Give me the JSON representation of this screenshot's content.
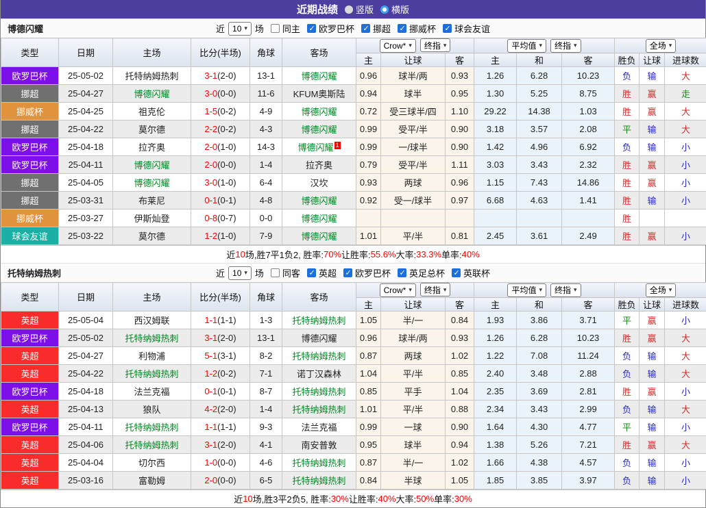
{
  "title_bar": {
    "title": "近期战绩",
    "radio_vertical": "竖版",
    "radio_horizontal": "横版"
  },
  "colors": {
    "titlebar_bg": "#4c3e9e",
    "league_colors": {
      "欧罗巴杯": "#7d10e8",
      "挪超": "#707070",
      "挪威杯": "#e0923c",
      "球会友谊": "#1cb0a4",
      "英超": "#fa2b2b"
    },
    "result_colors": {
      "胜": "rr",
      "负": "rb",
      "平": "rg",
      "赢": "rr",
      "输": "rb",
      "走": "rg",
      "大": "rr",
      "小": "rb"
    },
    "team_highlight": "#008822",
    "score_red": "#ff0000"
  },
  "header": {
    "main_cols": [
      "类型",
      "日期",
      "主场",
      "比分(半场)",
      "角球",
      "客场"
    ],
    "sub_cols": [
      "主",
      "让球",
      "客",
      "主",
      "和",
      "客",
      "胜负",
      "让球",
      "进球数"
    ],
    "select_groups": [
      [
        "Crow*",
        "终指"
      ],
      [
        "平均值",
        "终指"
      ],
      [
        "全场"
      ]
    ]
  },
  "sections": [
    {
      "team": "博德闪耀",
      "filter": {
        "prefix": "近",
        "count": "10",
        "suffix": "场",
        "same_label": "同主",
        "same_checked": false,
        "leagues": [
          "欧罗巴杯",
          "挪超",
          "挪威杯",
          "球会友谊"
        ]
      },
      "rows": [
        {
          "league": "欧罗巴杯",
          "date": "25-05-02",
          "home": "托特纳姆热刺",
          "home_green": false,
          "score": "3-1",
          "half": "(2-0)",
          "corner": "13-1",
          "away": "博德闪耀",
          "away_green": true,
          "away_card": "",
          "lh": "0.96",
          "line": "球半/两",
          "la": "0.93",
          "ah": "1.26",
          "ad": "6.28",
          "aa": "10.23",
          "r1": "负",
          "r2": "输",
          "r3": "大"
        },
        {
          "league": "挪超",
          "date": "25-04-27",
          "home": "博德闪耀",
          "home_green": true,
          "score": "3-0",
          "half": "(0-0)",
          "corner": "11-6",
          "away": "KFUM奥斯陆",
          "away_green": false,
          "away_card": "",
          "lh": "0.94",
          "line": "球半",
          "la": "0.95",
          "ah": "1.30",
          "ad": "5.25",
          "aa": "8.75",
          "r1": "胜",
          "r2": "赢",
          "r3": "走"
        },
        {
          "league": "挪威杯",
          "date": "25-04-25",
          "home": "祖克伦",
          "home_green": false,
          "score": "1-5",
          "half": "(0-2)",
          "corner": "4-9",
          "away": "博德闪耀",
          "away_green": true,
          "away_card": "",
          "lh": "0.72",
          "line": "受三球半/四",
          "la": "1.10",
          "ah": "29.22",
          "ad": "14.38",
          "aa": "1.03",
          "r1": "胜",
          "r2": "赢",
          "r3": "大"
        },
        {
          "league": "挪超",
          "date": "25-04-22",
          "home": "莫尔德",
          "home_green": false,
          "score": "2-2",
          "half": "(0-2)",
          "corner": "4-3",
          "away": "博德闪耀",
          "away_green": true,
          "away_card": "",
          "lh": "0.99",
          "line": "受平/半",
          "la": "0.90",
          "ah": "3.18",
          "ad": "3.57",
          "aa": "2.08",
          "r1": "平",
          "r2": "输",
          "r3": "大"
        },
        {
          "league": "欧罗巴杯",
          "date": "25-04-18",
          "home": "拉齐奥",
          "home_green": false,
          "score": "2-0",
          "half": "(1-0)",
          "corner": "14-3",
          "away": "博德闪耀",
          "away_green": true,
          "away_card": "1",
          "lh": "0.99",
          "line": "一/球半",
          "la": "0.90",
          "ah": "1.42",
          "ad": "4.96",
          "aa": "6.92",
          "r1": "负",
          "r2": "输",
          "r3": "小"
        },
        {
          "league": "欧罗巴杯",
          "date": "25-04-11",
          "home": "博德闪耀",
          "home_green": true,
          "score": "2-0",
          "half": "(0-0)",
          "corner": "1-4",
          "away": "拉齐奥",
          "away_green": false,
          "away_card": "",
          "lh": "0.79",
          "line": "受平/半",
          "la": "1.11",
          "ah": "3.03",
          "ad": "3.43",
          "aa": "2.32",
          "r1": "胜",
          "r2": "赢",
          "r3": "小"
        },
        {
          "league": "挪超",
          "date": "25-04-05",
          "home": "博德闪耀",
          "home_green": true,
          "score": "3-0",
          "half": "(1-0)",
          "corner": "6-4",
          "away": "汉坎",
          "away_green": false,
          "away_card": "",
          "lh": "0.93",
          "line": "两球",
          "la": "0.96",
          "ah": "1.15",
          "ad": "7.43",
          "aa": "14.86",
          "r1": "胜",
          "r2": "赢",
          "r3": "小"
        },
        {
          "league": "挪超",
          "date": "25-03-31",
          "home": "布莱尼",
          "home_green": false,
          "score": "0-1",
          "half": "(0-1)",
          "corner": "4-8",
          "away": "博德闪耀",
          "away_green": true,
          "away_card": "",
          "lh": "0.92",
          "line": "受一/球半",
          "la": "0.97",
          "ah": "6.68",
          "ad": "4.63",
          "aa": "1.41",
          "r1": "胜",
          "r2": "输",
          "r3": "小"
        },
        {
          "league": "挪威杯",
          "date": "25-03-27",
          "home": "伊斯灿登",
          "home_green": false,
          "score": "0-8",
          "half": "(0-7)",
          "corner": "0-0",
          "away": "博德闪耀",
          "away_green": true,
          "away_card": "",
          "lh": "",
          "line": "",
          "la": "",
          "ah": "",
          "ad": "",
          "aa": "",
          "r1": "胜",
          "r2": "",
          "r3": ""
        },
        {
          "league": "球会友谊",
          "date": "25-03-22",
          "home": "莫尔德",
          "home_green": false,
          "score": "1-2",
          "half": "(1-0)",
          "corner": "7-9",
          "away": "博德闪耀",
          "away_green": true,
          "away_card": "",
          "lh": "1.01",
          "line": "平/半",
          "la": "0.81",
          "ah": "2.45",
          "ad": "3.61",
          "aa": "2.49",
          "r1": "胜",
          "r2": "赢",
          "r3": "小"
        }
      ],
      "summary": [
        [
          "近",
          "k"
        ],
        [
          "10",
          "r"
        ],
        [
          "场,胜7平1负2, 胜率:",
          "k"
        ],
        [
          "70%",
          "r"
        ],
        [
          " 让胜率:",
          "k"
        ],
        [
          "55.6%",
          "r"
        ],
        [
          " 大率:",
          "k"
        ],
        [
          "33.3%",
          "r"
        ],
        [
          " 单率:",
          "k"
        ],
        [
          "40%",
          "r"
        ]
      ]
    },
    {
      "team": "托特纳姆热刺",
      "filter": {
        "prefix": "近",
        "count": "10",
        "suffix": "场",
        "same_label": "同客",
        "same_checked": false,
        "leagues": [
          "英超",
          "欧罗巴杯",
          "英足总杯",
          "英联杯"
        ]
      },
      "rows": [
        {
          "league": "英超",
          "date": "25-05-04",
          "home": "西汉姆联",
          "home_green": false,
          "score": "1-1",
          "half": "(1-1)",
          "corner": "1-3",
          "away": "托特纳姆热刺",
          "away_green": true,
          "away_card": "",
          "lh": "1.05",
          "line": "半/一",
          "la": "0.84",
          "ah": "1.93",
          "ad": "3.86",
          "aa": "3.71",
          "r1": "平",
          "r2": "赢",
          "r3": "小"
        },
        {
          "league": "欧罗巴杯",
          "date": "25-05-02",
          "home": "托特纳姆热刺",
          "home_green": true,
          "score": "3-1",
          "half": "(2-0)",
          "corner": "13-1",
          "away": "博德闪耀",
          "away_green": false,
          "away_card": "",
          "lh": "0.96",
          "line": "球半/两",
          "la": "0.93",
          "ah": "1.26",
          "ad": "6.28",
          "aa": "10.23",
          "r1": "胜",
          "r2": "赢",
          "r3": "大"
        },
        {
          "league": "英超",
          "date": "25-04-27",
          "home": "利物浦",
          "home_green": false,
          "score": "5-1",
          "half": "(3-1)",
          "corner": "8-2",
          "away": "托特纳姆热刺",
          "away_green": true,
          "away_card": "",
          "lh": "0.87",
          "line": "两球",
          "la": "1.02",
          "ah": "1.22",
          "ad": "7.08",
          "aa": "11.24",
          "r1": "负",
          "r2": "输",
          "r3": "大"
        },
        {
          "league": "英超",
          "date": "25-04-22",
          "home": "托特纳姆热刺",
          "home_green": true,
          "score": "1-2",
          "half": "(0-2)",
          "corner": "7-1",
          "away": "诺丁汉森林",
          "away_green": false,
          "away_card": "",
          "lh": "1.04",
          "line": "平/半",
          "la": "0.85",
          "ah": "2.40",
          "ad": "3.48",
          "aa": "2.88",
          "r1": "负",
          "r2": "输",
          "r3": "大"
        },
        {
          "league": "欧罗巴杯",
          "date": "25-04-18",
          "home": "法兰克福",
          "home_green": false,
          "score": "0-1",
          "half": "(0-1)",
          "corner": "8-7",
          "away": "托特纳姆热刺",
          "away_green": true,
          "away_card": "",
          "lh": "0.85",
          "line": "平手",
          "la": "1.04",
          "ah": "2.35",
          "ad": "3.69",
          "aa": "2.81",
          "r1": "胜",
          "r2": "赢",
          "r3": "小"
        },
        {
          "league": "英超",
          "date": "25-04-13",
          "home": "狼队",
          "home_green": false,
          "score": "4-2",
          "half": "(2-0)",
          "corner": "1-4",
          "away": "托特纳姆热刺",
          "away_green": true,
          "away_card": "",
          "lh": "1.01",
          "line": "平/半",
          "la": "0.88",
          "ah": "2.34",
          "ad": "3.43",
          "aa": "2.99",
          "r1": "负",
          "r2": "输",
          "r3": "大"
        },
        {
          "league": "欧罗巴杯",
          "date": "25-04-11",
          "home": "托特纳姆热刺",
          "home_green": true,
          "score": "1-1",
          "half": "(1-1)",
          "corner": "9-3",
          "away": "法兰克福",
          "away_green": false,
          "away_card": "",
          "lh": "0.99",
          "line": "一球",
          "la": "0.90",
          "ah": "1.64",
          "ad": "4.30",
          "aa": "4.77",
          "r1": "平",
          "r2": "输",
          "r3": "小"
        },
        {
          "league": "英超",
          "date": "25-04-06",
          "home": "托特纳姆热刺",
          "home_green": true,
          "score": "3-1",
          "half": "(2-0)",
          "corner": "4-1",
          "away": "南安普敦",
          "away_green": false,
          "away_card": "",
          "lh": "0.95",
          "line": "球半",
          "la": "0.94",
          "ah": "1.38",
          "ad": "5.26",
          "aa": "7.21",
          "r1": "胜",
          "r2": "赢",
          "r3": "大"
        },
        {
          "league": "英超",
          "date": "25-04-04",
          "home": "切尔西",
          "home_green": false,
          "score": "1-0",
          "half": "(0-0)",
          "corner": "4-6",
          "away": "托特纳姆热刺",
          "away_green": true,
          "away_card": "",
          "lh": "0.87",
          "line": "半/一",
          "la": "1.02",
          "ah": "1.66",
          "ad": "4.38",
          "aa": "4.57",
          "r1": "负",
          "r2": "输",
          "r3": "小"
        },
        {
          "league": "英超",
          "date": "25-03-16",
          "home": "富勒姆",
          "home_green": false,
          "score": "2-0",
          "half": "(0-0)",
          "corner": "6-5",
          "away": "托特纳姆热刺",
          "away_green": true,
          "away_card": "",
          "lh": "0.84",
          "line": "半球",
          "la": "1.05",
          "ah": "1.85",
          "ad": "3.85",
          "aa": "3.97",
          "r1": "负",
          "r2": "输",
          "r3": "小"
        }
      ],
      "summary": [
        [
          "近",
          "k"
        ],
        [
          "10",
          "r"
        ],
        [
          "场,胜3平2负5, 胜率:",
          "k"
        ],
        [
          "30%",
          "r"
        ],
        [
          " 让胜率:",
          "k"
        ],
        [
          "40%",
          "r"
        ],
        [
          " 大率:",
          "k"
        ],
        [
          "50%",
          "r"
        ],
        [
          " 单率:",
          "k"
        ],
        [
          "30%",
          "r"
        ]
      ]
    }
  ]
}
